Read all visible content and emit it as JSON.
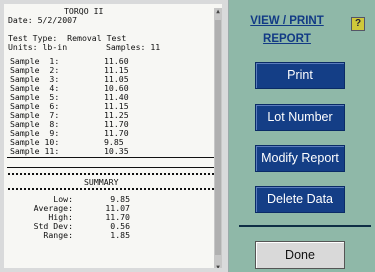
{
  "report": {
    "heading": "TORQO II",
    "date_line": "Date: 5/2/2007",
    "test_type_line": "Test Type:  Removal Test",
    "units_line": "Units: lb-in",
    "samples_line": "Samples: 11",
    "samples": [
      {
        "label": "Sample  1:",
        "value": "11.60"
      },
      {
        "label": "Sample  2:",
        "value": "11.15"
      },
      {
        "label": "Sample  3:",
        "value": "11.05"
      },
      {
        "label": "Sample  4:",
        "value": "10.60"
      },
      {
        "label": "Sample  5:",
        "value": "11.40"
      },
      {
        "label": "Sample  6:",
        "value": "11.15"
      },
      {
        "label": "Sample  7:",
        "value": "11.25"
      },
      {
        "label": "Sample  8:",
        "value": "11.70"
      },
      {
        "label": "Sample  9:",
        "value": "11.70"
      },
      {
        "label": "Sample 10:",
        "value": "9.85"
      },
      {
        "label": "Sample 11:",
        "value": "10.35"
      }
    ],
    "summary_title": "SUMMARY",
    "summary": [
      {
        "label": "Low:",
        "value": "9.85"
      },
      {
        "label": "Average:",
        "value": "11.07"
      },
      {
        "label": "High:",
        "value": "11.70"
      },
      {
        "label": "Std Dev:",
        "value": "0.56"
      },
      {
        "label": "Range:",
        "value": "1.85"
      }
    ]
  },
  "panel": {
    "title_line1": "VIEW / PRINT",
    "title_line2": "REPORT",
    "help_label": "?",
    "print_label": "Print",
    "lot_number_label": "Lot Number",
    "modify_report_label": "Modify Report",
    "delete_data_label": "Delete Data",
    "done_label": "Done"
  },
  "colors": {
    "background": "#8fb8a8",
    "button_blue": "#143e86",
    "title_blue": "#123a85",
    "help_yellow": "#cfc83a"
  }
}
